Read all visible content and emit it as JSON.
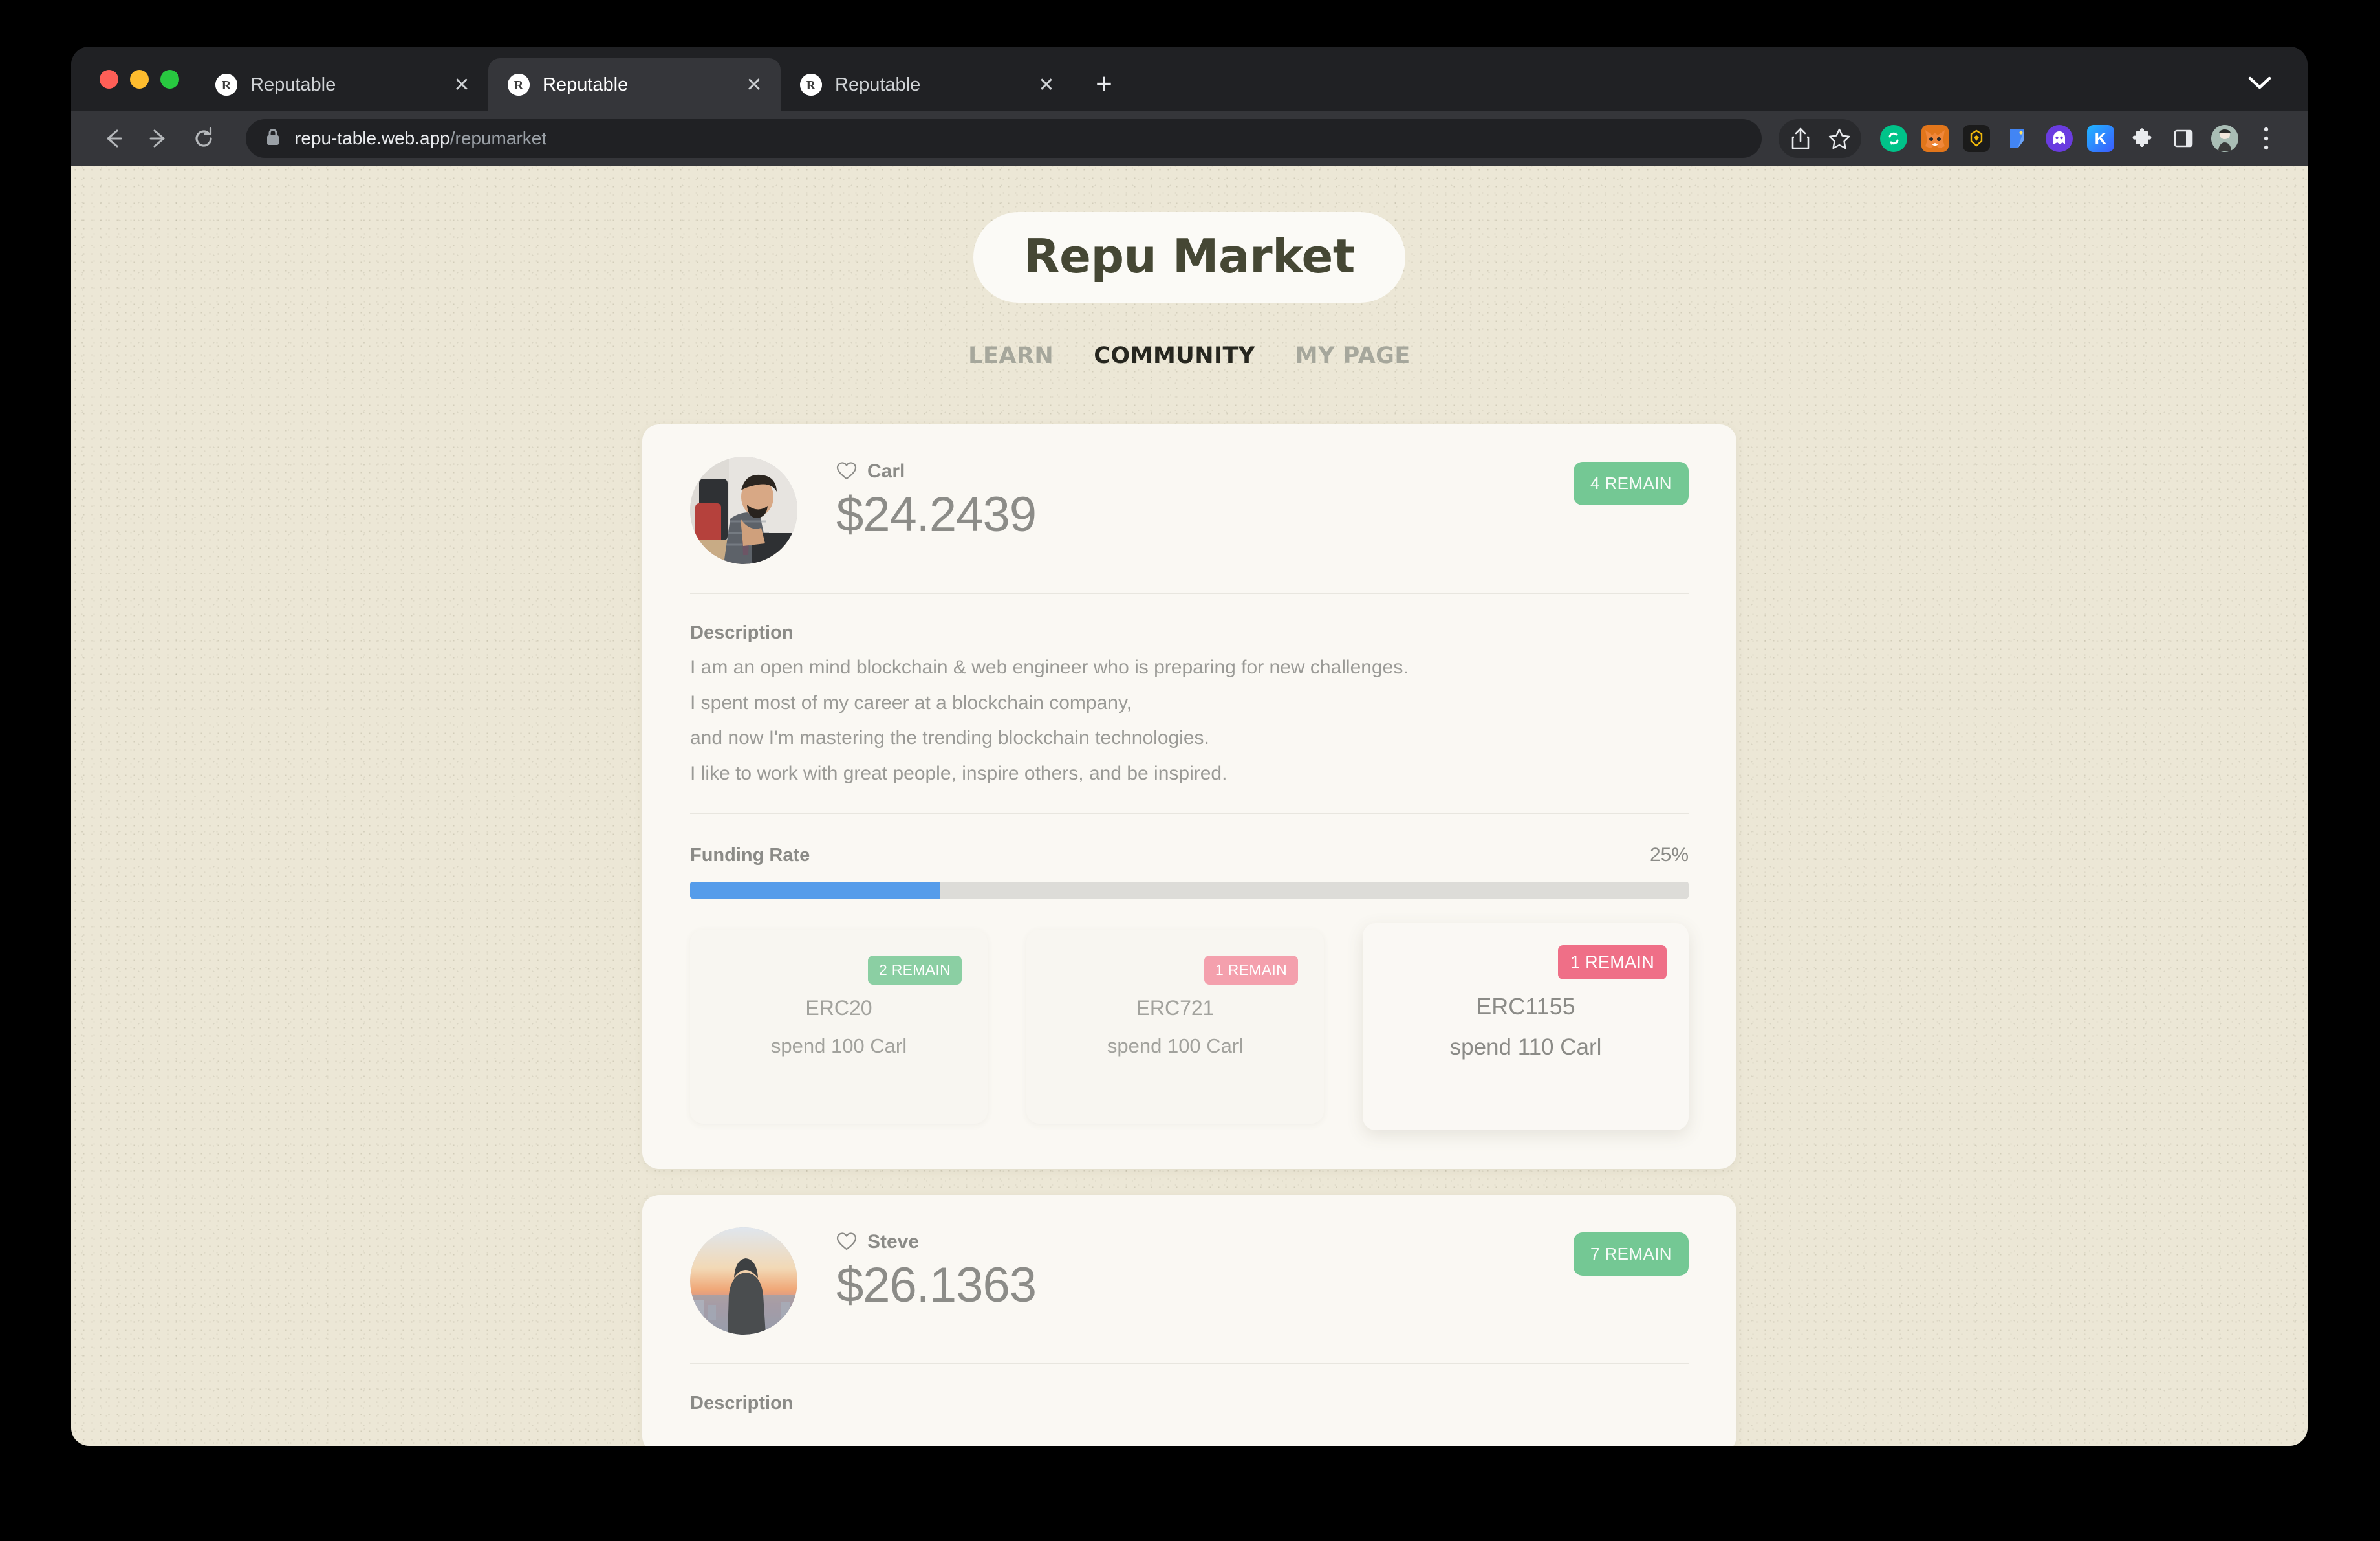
{
  "browser": {
    "tabs": [
      {
        "title": "Reputable",
        "favicon": "reputable-favicon",
        "active": false
      },
      {
        "title": "Reputable",
        "favicon": "reputable-favicon",
        "active": true
      },
      {
        "title": "Reputable",
        "favicon": "reputable-favicon",
        "active": false
      }
    ],
    "new_tab_label": "+",
    "url_domain": "repu-table.web.app",
    "url_path": "/repumarket",
    "toolbar_icons": [
      "back-icon",
      "forward-icon",
      "reload-icon",
      "lock-icon",
      "share-icon",
      "bookmark-star-icon",
      "ext-phantom-swap-icon",
      "ext-metamask-icon",
      "ext-binance-icon",
      "ext-blue-wallet-icon",
      "ext-ghost-icon",
      "ext-kaikas-icon",
      "extensions-puzzle-icon",
      "side-panel-icon",
      "profile-avatar-icon",
      "chrome-menu-icon"
    ],
    "ext_labels": {
      "kaikas": "K"
    }
  },
  "site": {
    "title": "Repu Market",
    "nav": [
      {
        "label": "LEARN",
        "active": false
      },
      {
        "label": "COMMUNITY",
        "active": true
      },
      {
        "label": "MY PAGE",
        "active": false
      }
    ]
  },
  "colors": {
    "page_bg": "#ece7d6",
    "card_bg": "#faf8f3",
    "title_text": "#454734",
    "nav_active": "#26261f",
    "nav_inactive": "#a6a79c",
    "badge_green": "#74c894",
    "badge_pink": "#f4a0ad",
    "badge_pink_strong": "#ef6f87",
    "progress_fill": "#559cea",
    "progress_track": "#dddcd8",
    "muted_text": "#9a9a96"
  },
  "cards": [
    {
      "name": "Carl",
      "avatar": "bearded-man-at-desk-photo",
      "price": "$24.2439",
      "remain_badge": "4 REMAIN",
      "description_label": "Description",
      "description_lines": [
        "I am an open mind blockchain & web engineer who is preparing for new challenges.",
        "I spent most of my career at a blockchain company,",
        "and now I'm mastering the trending blockchain technologies.",
        "I like to work with great people, inspire others, and be inspired."
      ],
      "funding_label": "Funding Rate",
      "funding_percent_text": "25%",
      "funding_percent_value": 25,
      "tokens": [
        {
          "name": "ERC20",
          "sub": "spend 100 Carl",
          "badge": "2 REMAIN",
          "badge_style": "green",
          "hovered": false
        },
        {
          "name": "ERC721",
          "sub": "spend 100 Carl",
          "badge": "1 REMAIN",
          "badge_style": "pink",
          "hovered": false
        },
        {
          "name": "ERC1155",
          "sub": "spend 110 Carl",
          "badge": "1 REMAIN",
          "badge_style": "pink-strong",
          "hovered": true
        }
      ]
    },
    {
      "name": "Steve",
      "avatar": "hooded-figure-sunset-photo",
      "price": "$26.1363",
      "remain_badge": "7 REMAIN",
      "description_label": "Description"
    }
  ]
}
